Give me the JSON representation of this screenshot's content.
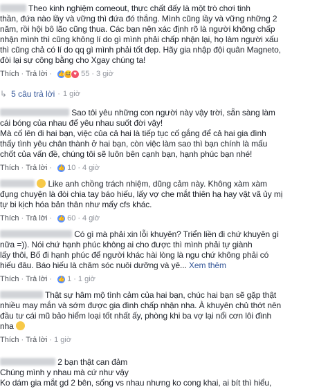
{
  "comments": [
    {
      "lines": [
        "Theo kinh nghiệm comeout, thực chất đấy là một trò chơi tinh",
        "thần, đứa nào lầy và vững thì đứa đó thắng. Mình cũng lầy và vững những 2",
        "năm, rồi hội bô lão cũng thua. Các bạn nên xác định rõ là người không chấp",
        "nhận mình thì cũng không lí do gì mình phải chấp nhận lại, họ làm người xấu",
        "thì cũng chả có lí do qq gì mình phải tốt đẹp. Hãy gia nhập đội quân Magneto,",
        "đòi lại sự công bằng cho Xgay chúng ta!"
      ],
      "meta": {
        "like": "Thích",
        "reply": "Trả lời",
        "reactions": "55",
        "time": "3 giờ"
      }
    },
    {
      "replies": {
        "label": "5 câu trả lời",
        "time": "1 giờ"
      }
    },
    {
      "lines": [
        "Sao tôi yêu những con người này vậy trời, sẵn sàng làm",
        "cái bóng của nhau để yêu nhau suốt đời vậy!",
        "Mà cố lên đi hai bạn, việc của cả hai là tiếp tục cố gắng để cả hai gia đình",
        "thấy tình yêu chân thành ở hai bạn, còn việc làm sao thì bạn chính là mấu",
        "chốt của vấn đề, chúng tôi sẽ luôn bên cạnh bạn, hạnh phúc bạn nhé!"
      ],
      "meta": {
        "like": "Thích",
        "reply": "Trả lời",
        "reactions": "10",
        "time": "4 giờ"
      }
    },
    {
      "lines": [
        "Like anh chồng trách nhiệm, dũng cảm này. Không xàm xàm",
        "đụng chuyện là đòi chia tay báo hiếu, lấy vợ che mắt thiên hạ hay vật vã ủy mị",
        "tự bi kịch hóa bản thân như mấy cfs khác."
      ],
      "meta": {
        "like": "Thích",
        "reply": "Trả lời",
        "reactions": "60",
        "time": "4 giờ"
      }
    },
    {
      "lines": [
        "Có gì mà phải xin lỗi khuyên? Triển liền đi chứ khuyên gì",
        "nữa =)). Nói chứ hạnh phúc không ai cho được thì mình phải tự giành",
        "lấy thôi, Bố đi hạnh phúc để người khác hài lòng là ngu chứ không phải có",
        "hiếu đâu. Báo hiếu là chăm sóc nuôi dưỡng và yê...",
        "Xem thêm"
      ],
      "edited": "Đã chỉnh sửa",
      "meta": {
        "like": "Thích",
        "reply": "Trả lời",
        "reactions": "1",
        "time": "1 giờ"
      }
    },
    {
      "lines": [
        "Thật sự hâm mộ tình cảm của hai bạn, chúc hai bạn sẽ gặp thật",
        "nhiều may mắn và sớm được gia đình chấp nhận nha. À khuyên chủ thớt nên",
        "đầu tư cái mũ bảo hiểm loại tốt nhất ấy, phòng khi ba vợ lại nổi cơn lôi đình",
        "nha"
      ],
      "meta": {
        "like": "Thích",
        "reply": "Trả lời",
        "time": "1 giờ"
      }
    },
    {
      "lines": [
        "2 bạn thật can đảm",
        "Chúng mình y nhau mà cứ như vậy",
        "Ko dám gia mắt gd 2 bên, sống vs nhau nhưng ko cong khai, ai bít thì hiểu,"
      ]
    }
  ]
}
